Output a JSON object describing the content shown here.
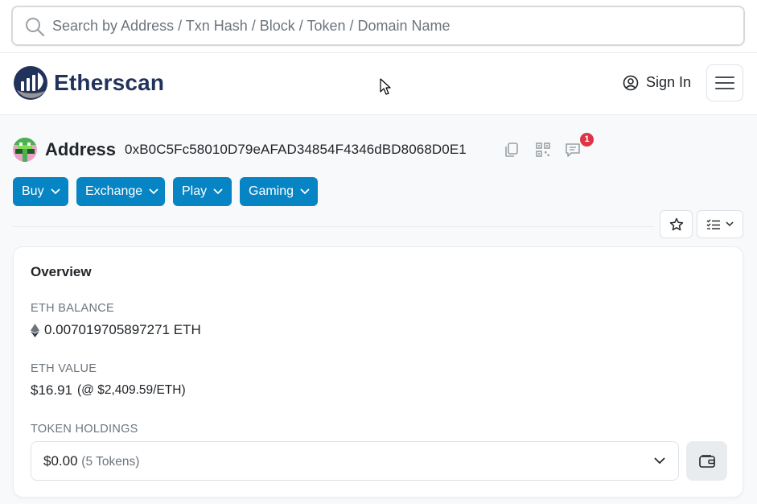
{
  "search": {
    "placeholder": "Search by Address / Txn Hash / Block / Token / Domain Name"
  },
  "header": {
    "brand": "Etherscan",
    "signin_label": "Sign In"
  },
  "address": {
    "label": "Address",
    "hash": "0xB0C5Fc58010D79eAFAD34854F4346dBD8068D0E1",
    "notification_count": "1"
  },
  "actions": [
    {
      "label": "Buy"
    },
    {
      "label": "Exchange"
    },
    {
      "label": "Play"
    },
    {
      "label": "Gaming"
    }
  ],
  "overview": {
    "title": "Overview",
    "eth_balance_label": "ETH BALANCE",
    "eth_balance_value": "0.007019705897271 ETH",
    "eth_value_label": "ETH VALUE",
    "eth_value_amount": "$16.91",
    "eth_value_rate": "(@ $2,409.59/ETH)",
    "token_holdings_label": "TOKEN HOLDINGS",
    "token_holdings_value": "$0.00",
    "token_holdings_count": "(5 Tokens)"
  },
  "colors": {
    "primary": "#0784c3",
    "brand_navy": "#21325b",
    "badge": "#dc3545"
  },
  "icons": [
    "search-icon",
    "etherscan-logo-icon",
    "user-circle-icon",
    "hamburger-menu-icon",
    "copy-icon",
    "qr-code-icon",
    "comment-icon",
    "chevron-down-icon",
    "star-icon",
    "list-check-icon",
    "eth-diamond-icon",
    "wallet-icon"
  ]
}
